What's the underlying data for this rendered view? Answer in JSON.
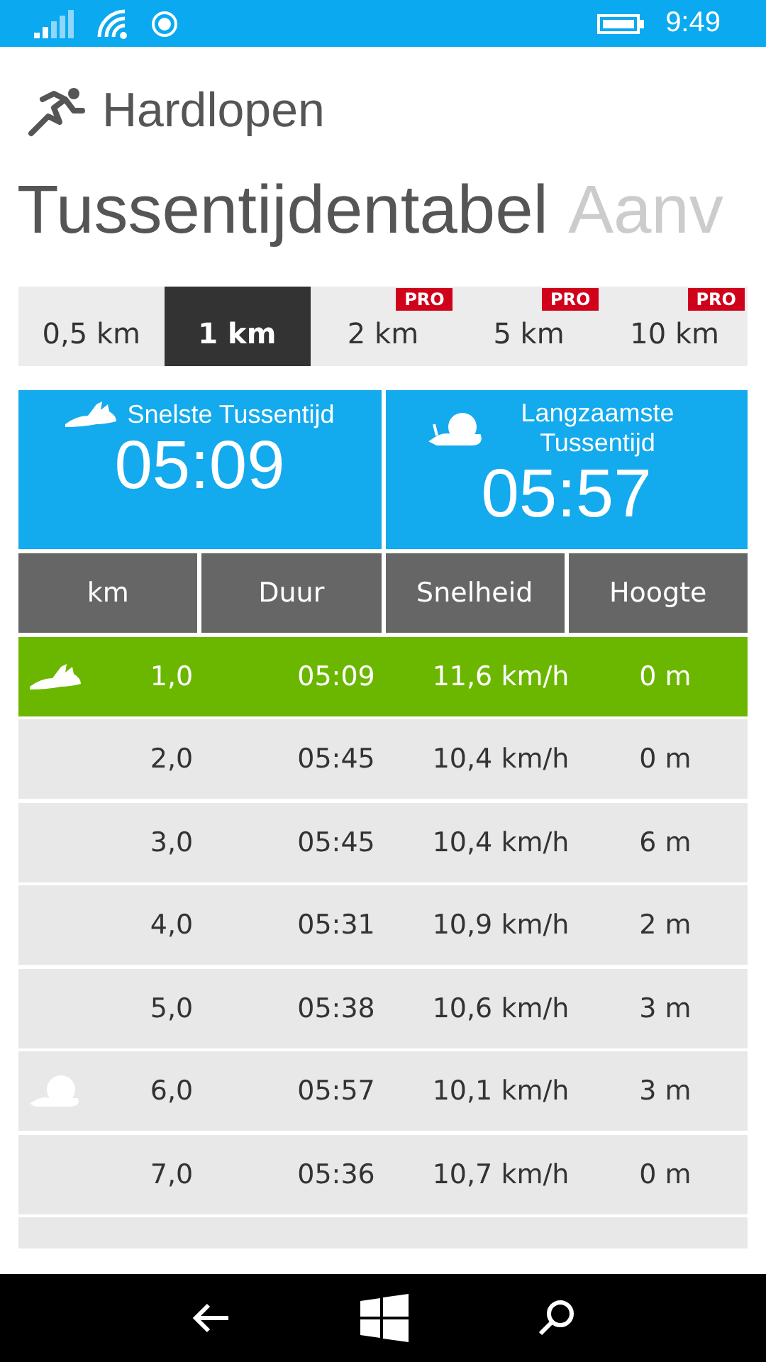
{
  "status_bar": {
    "time": "9:49"
  },
  "app": {
    "title": "Hardlopen"
  },
  "pivot": [
    {
      "label": "Tussentijdentabel",
      "selected": true
    },
    {
      "label": "Aanv",
      "selected": false
    }
  ],
  "distance_tabs": [
    {
      "label": "0,5 km",
      "selected": false,
      "pro": false
    },
    {
      "label": "1 km",
      "selected": true,
      "pro": false
    },
    {
      "label": "2 km",
      "selected": false,
      "pro": true,
      "badge": "PRO"
    },
    {
      "label": "5 km",
      "selected": false,
      "pro": true,
      "badge": "PRO"
    },
    {
      "label": "10 km",
      "selected": false,
      "pro": true,
      "badge": "PRO"
    }
  ],
  "summary": [
    {
      "kind": "fastest",
      "label": "Snelste Tussentijd",
      "value": "05:09"
    },
    {
      "kind": "slowest",
      "label": "Langzaamste Tussentijd",
      "value": "05:57"
    }
  ],
  "table": {
    "columns": [
      "km",
      "Duur",
      "Snelheid",
      "Hoogte"
    ],
    "rows": [
      {
        "kind": "fastest",
        "highlighted": true,
        "cells": [
          "1,0",
          "05:09",
          "11,6 km/h",
          "0 m"
        ]
      },
      {
        "kind": "plain",
        "highlighted": false,
        "cells": [
          "2,0",
          "05:45",
          "10,4 km/h",
          "0 m"
        ]
      },
      {
        "kind": "plain",
        "highlighted": false,
        "cells": [
          "3,0",
          "05:45",
          "10,4 km/h",
          "6 m"
        ]
      },
      {
        "kind": "plain",
        "highlighted": false,
        "cells": [
          "4,0",
          "05:31",
          "10,9 km/h",
          "2 m"
        ]
      },
      {
        "kind": "plain",
        "highlighted": false,
        "cells": [
          "5,0",
          "05:38",
          "10,6 km/h",
          "3 m"
        ]
      },
      {
        "kind": "slowest",
        "highlighted": false,
        "cells": [
          "6,0",
          "05:57",
          "10,1 km/h",
          "3 m"
        ]
      },
      {
        "kind": "plain",
        "highlighted": false,
        "cells": [
          "7,0",
          "05:36",
          "10,7 km/h",
          "0 m"
        ]
      }
    ]
  }
}
